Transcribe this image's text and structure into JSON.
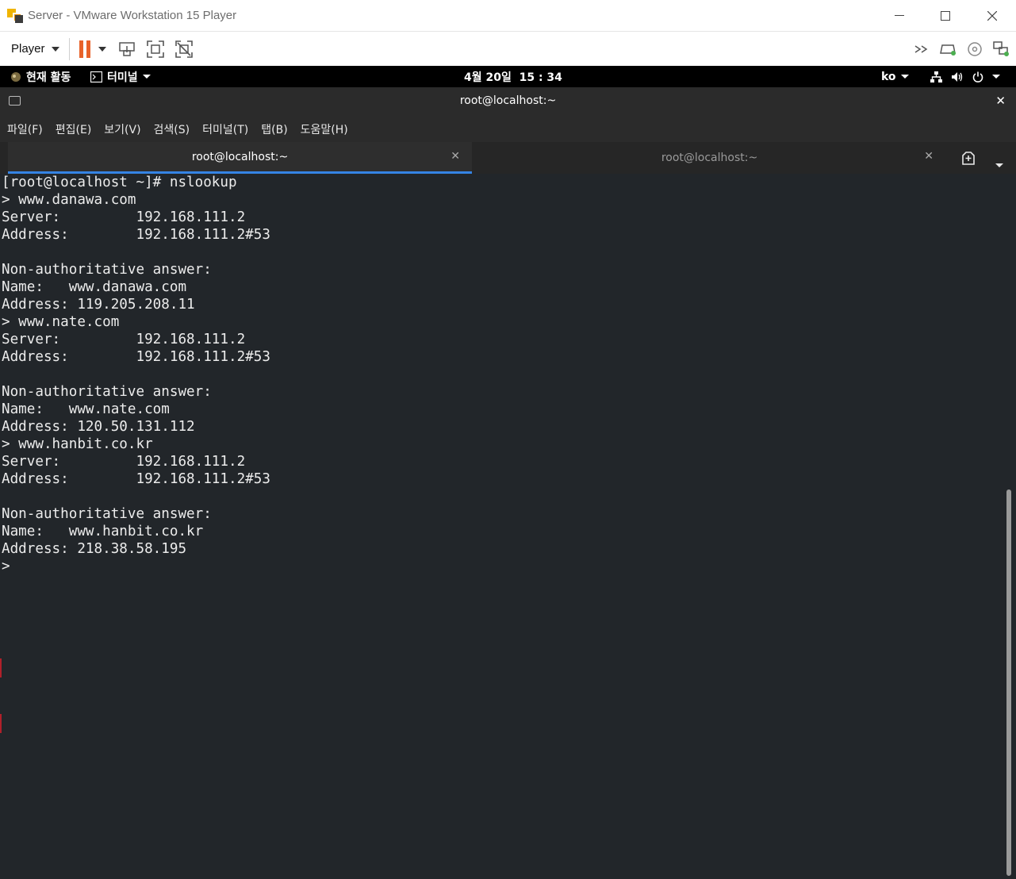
{
  "vmware": {
    "title": "Server - VMware Workstation 15 Player",
    "player_menu": "Player",
    "accent": "#e8622a"
  },
  "gnome": {
    "activities": "현재 활동",
    "app_menu": "터미널",
    "clock": "4월 20일  15 : 34",
    "input_method": "ko"
  },
  "terminal": {
    "window_title": "root@localhost:~",
    "menu": [
      "파일(F)",
      "편집(E)",
      "보기(V)",
      "검색(S)",
      "터미널(T)",
      "탭(B)",
      "도움말(H)"
    ],
    "tabs": [
      {
        "label": "root@localhost:~",
        "active": true
      },
      {
        "label": "root@localhost:~",
        "active": false
      }
    ],
    "lines": [
      "[root@localhost ~]# nslookup",
      "> www.danawa.com",
      "Server:\t\t192.168.111.2",
      "Address:\t192.168.111.2#53",
      "",
      "Non-authoritative answer:",
      "Name:\twww.danawa.com",
      "Address: 119.205.208.11",
      "> www.nate.com",
      "Server:\t\t192.168.111.2",
      "Address:\t192.168.111.2#53",
      "",
      "Non-authoritative answer:",
      "Name:\twww.nate.com",
      "Address: 120.50.131.112",
      "> www.hanbit.co.kr",
      "Server:\t\t192.168.111.2",
      "Address:\t192.168.111.2#53",
      "",
      "Non-authoritative answer:",
      "Name:\twww.hanbit.co.kr",
      "Address: 218.38.58.195",
      "> "
    ],
    "background": "#22262a",
    "tab_accent": "#3584e4"
  }
}
